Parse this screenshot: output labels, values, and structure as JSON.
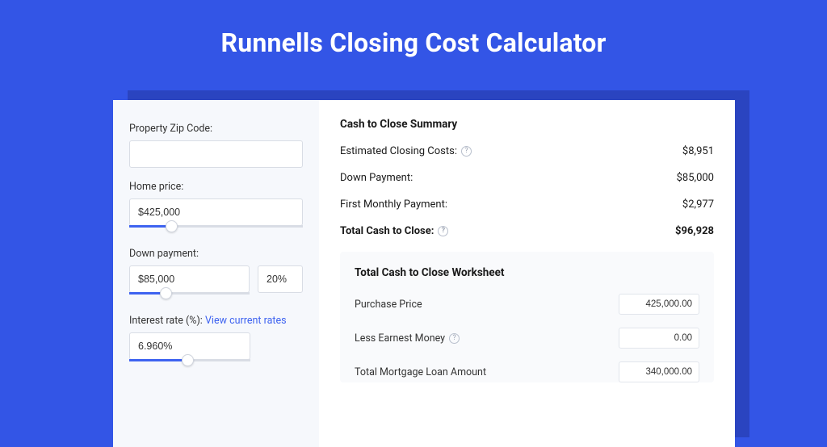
{
  "title": "Runnells Closing Cost Calculator",
  "form": {
    "zip": {
      "label": "Property Zip Code:",
      "value": ""
    },
    "home_price": {
      "label": "Home price:",
      "value": "$425,000",
      "slider_pct": 24
    },
    "down_payment": {
      "label": "Down payment:",
      "value": "$85,000",
      "pct": "20%",
      "slider_pct": 30
    },
    "interest_rate": {
      "label": "Interest rate (%):",
      "link": "View current rates",
      "value": "6.960%",
      "slider_pct": 48
    }
  },
  "summary": {
    "title": "Cash to Close Summary",
    "rows": [
      {
        "label": "Estimated Closing Costs:",
        "value": "$8,951",
        "help": true
      },
      {
        "label": "Down Payment:",
        "value": "$85,000",
        "help": false
      },
      {
        "label": "First Monthly Payment:",
        "value": "$2,977",
        "help": false
      }
    ],
    "total": {
      "label": "Total Cash to Close:",
      "value": "$96,928",
      "help": true
    }
  },
  "worksheet": {
    "title": "Total Cash to Close Worksheet",
    "rows": [
      {
        "label": "Purchase Price",
        "value": "425,000.00",
        "help": false
      },
      {
        "label": "Less Earnest Money",
        "value": "0.00",
        "help": true
      },
      {
        "label": "Total Mortgage Loan Amount",
        "value": "340,000.00",
        "help": false
      }
    ]
  }
}
